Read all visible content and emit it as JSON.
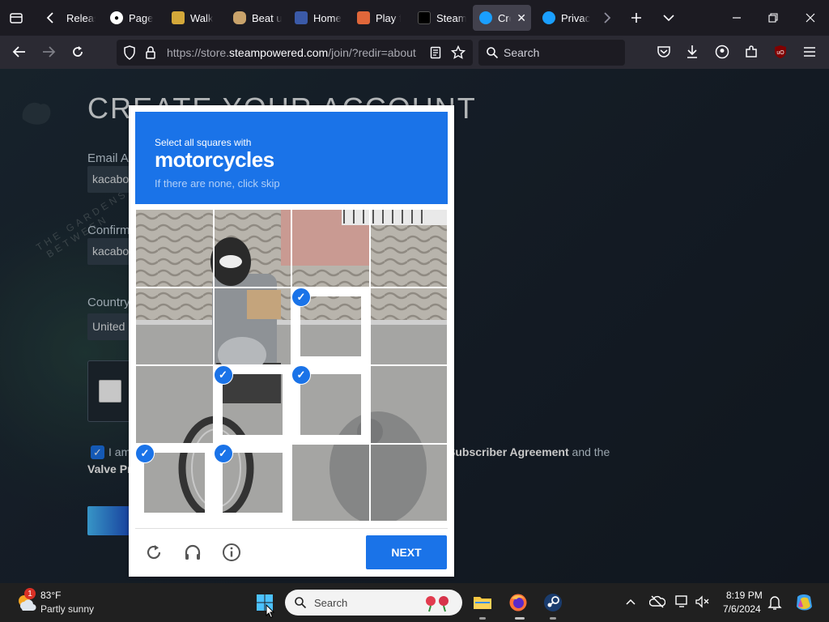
{
  "browser": {
    "tabs": [
      {
        "label": "Release"
      },
      {
        "label": "Page"
      },
      {
        "label": "Walk"
      },
      {
        "label": "Beat u"
      },
      {
        "label": "Home"
      },
      {
        "label": "Play f"
      },
      {
        "label": "Steam"
      },
      {
        "label": "Cre",
        "active": true
      },
      {
        "label": "Privac"
      }
    ],
    "url_prefix": "https://store.",
    "url_domain": "steampowered.com",
    "url_suffix": "/join/?redir=about",
    "search_placeholder": "Search"
  },
  "page": {
    "title": "CREATE YOUR ACCOUNT",
    "email_label": "Email Ac",
    "email_value": "kacabo",
    "confirm_label": "Confirm",
    "confirm_value": "kacabo",
    "country_label": "Country",
    "country_value": "United",
    "agree_prefix": "I am",
    "agree_link1": "Subscriber Agreement",
    "agree_and": "and the",
    "agree_link2": "Valve Pr",
    "decor_text1": "THE GARDENS",
    "decor_text2": "BETWEEN"
  },
  "captcha": {
    "instruction": "Select all squares with",
    "target": "motorcycles",
    "hint": "If there are none, click skip",
    "next_label": "NEXT",
    "selected_tiles": [
      6,
      9,
      10,
      12,
      13
    ]
  },
  "taskbar": {
    "weather_temp": "83°F",
    "weather_desc": "Partly sunny",
    "weather_badge": "1",
    "search_placeholder": "Search",
    "time": "8:19 PM",
    "date": "7/6/2024"
  },
  "colors": {
    "accent": "#1a73e8",
    "steam_bg": "#1b2838",
    "firefox_toolbar": "#2b2a33"
  }
}
